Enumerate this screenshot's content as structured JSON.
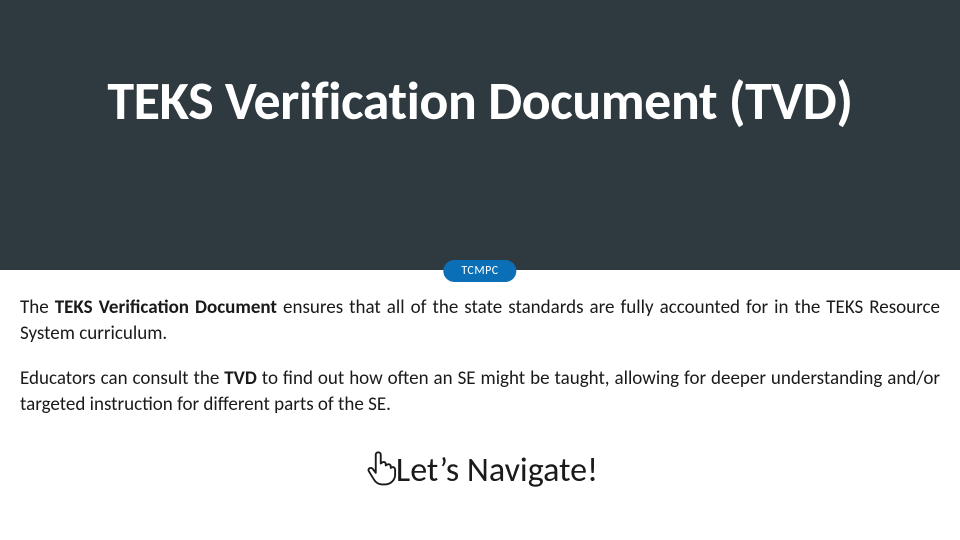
{
  "header": {
    "title": "TEKS Verification Document (TVD)",
    "pill": "TCMPC"
  },
  "body": {
    "para1_prefix": "The ",
    "para1_bold": "TEKS Verification Document",
    "para1_suffix": " ensures that all of the state standards are fully accounted for in the TEKS Resource System curriculum.",
    "para2_prefix": "Educators can consult the ",
    "para2_bold": "TVD",
    "para2_suffix": " to find out how often an SE might be taught, allowing for deeper understanding and/or targeted instruction for different parts of the SE."
  },
  "cta": {
    "label": "Let’s Navigate!"
  },
  "colors": {
    "header_bg": "#2f3a40",
    "pill_bg": "#0b6fb8"
  }
}
